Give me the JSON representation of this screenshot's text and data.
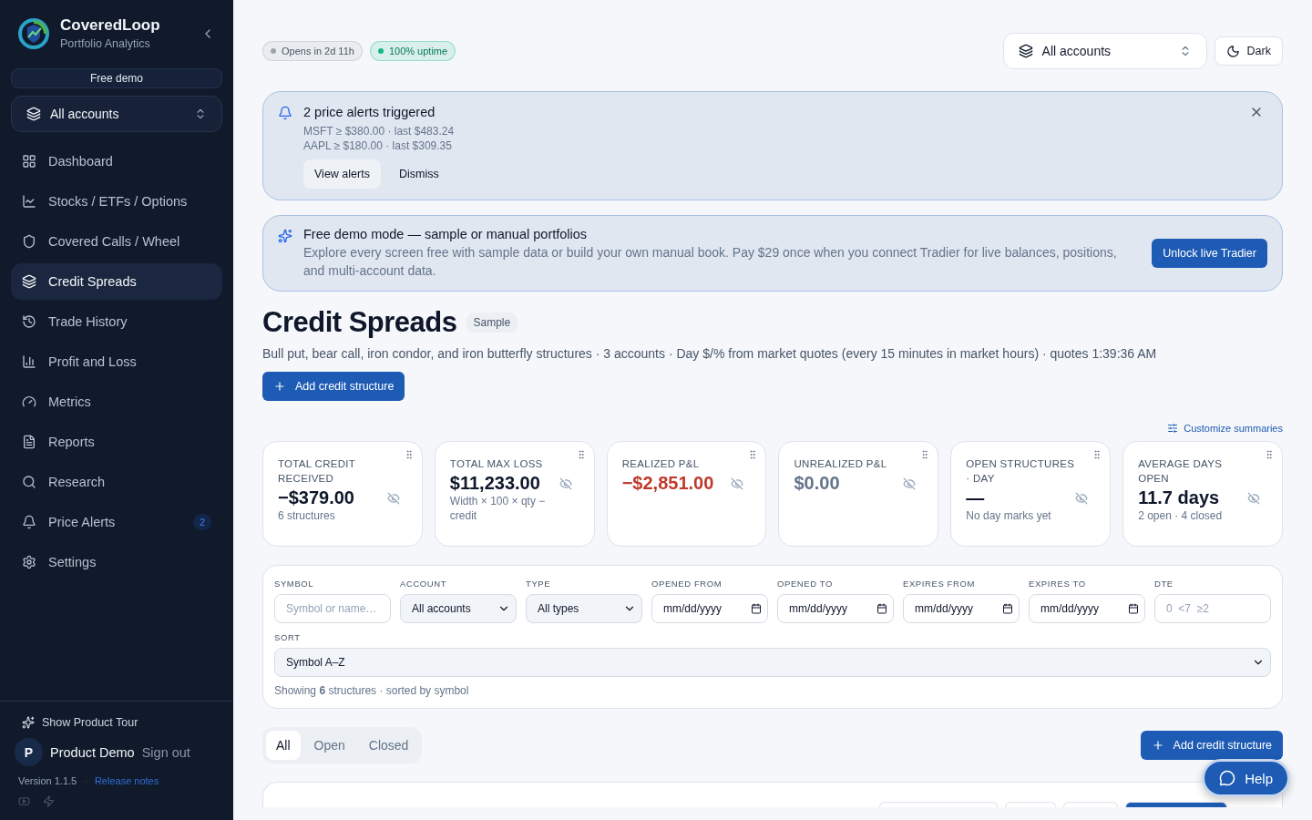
{
  "brand": {
    "name": "CoveredLoop",
    "tagline": "Portfolio Analytics"
  },
  "sidebar": {
    "plan_badge": "Free demo",
    "account_picker": "All accounts",
    "items": [
      {
        "label": "Dashboard",
        "selected": false
      },
      {
        "label": "Stocks / ETFs / Options",
        "selected": false
      },
      {
        "label": "Covered Calls / Wheel",
        "selected": false
      },
      {
        "label": "Credit Spreads",
        "selected": true
      },
      {
        "label": "Trade History",
        "selected": false
      },
      {
        "label": "Profit and Loss",
        "selected": false
      },
      {
        "label": "Metrics",
        "selected": false
      },
      {
        "label": "Reports",
        "selected": false
      },
      {
        "label": "Research",
        "selected": false
      },
      {
        "label": "Price Alerts",
        "selected": false,
        "badge": "2"
      },
      {
        "label": "Settings",
        "selected": false
      }
    ],
    "tour": "Show Product Tour",
    "avatar": "P",
    "user": "Product Demo",
    "sign_out": "Sign out",
    "version": "Version 1.1.5",
    "separator": "·",
    "release_notes": "Release notes"
  },
  "status_pills": [
    {
      "label": "Opens in 2d 11h",
      "color": "#9ca3af"
    },
    {
      "label": "100% uptime",
      "color": "#10b981"
    }
  ],
  "topbar": {
    "account_picker": "All accounts",
    "theme_button": "Dark"
  },
  "alert_banner": {
    "title": "2 price alerts triggered",
    "lines": [
      "MSFT ≥ $380.00 · last $483.24",
      "AAPL ≥ $180.00 · last $309.35"
    ],
    "buttons": [
      "View alerts",
      "Dismiss"
    ]
  },
  "demo_banner": {
    "title": "Free demo mode — sample or manual portfolios",
    "body": "Explore every screen free with sample data or build your own manual book. Pay $29 once when you connect Tradier for live balances, positions, and multi-account data.",
    "button": "Unlock live Tradier"
  },
  "page": {
    "title": "Credit Spreads",
    "badge": "Sample",
    "subtitle": "Bull put, bear call, iron condor, and iron butterfly structures · 3 accounts · Day $/% from market quotes (every 15 minutes in market hours) · quotes 1:39:36 AM",
    "add_button": "Add credit structure",
    "customize": "Customize summaries"
  },
  "summary_cards": [
    {
      "label": "TOTAL CREDIT RECEIVED",
      "value": "−$379.00",
      "color": "#0f172a",
      "note": "6 structures"
    },
    {
      "label": "TOTAL MAX LOSS",
      "value": "$11,233.00",
      "color": "#0f172a",
      "note": "Width × 100 × qty − credit"
    },
    {
      "label": "REALIZED P&L",
      "value": "−$2,851.00",
      "color": "#c0392b"
    },
    {
      "label": "UNREALIZED P&L",
      "value": "$0.00",
      "color": "#64748b"
    },
    {
      "label": "OPEN STRUCTURES · DAY",
      "value": "—",
      "color": "#0f172a",
      "note": "No day marks yet"
    },
    {
      "label": "AVERAGE DAYS OPEN",
      "value": "11.7 days",
      "color": "#0f172a",
      "note": "2 open · 4 closed"
    }
  ],
  "filters": [
    {
      "label": "SYMBOL",
      "kind": "text",
      "placeholder": "Symbol or name…"
    },
    {
      "label": "ACCOUNT",
      "kind": "select",
      "value": "All accounts"
    },
    {
      "label": "TYPE",
      "kind": "select",
      "value": "All types"
    },
    {
      "label": "OPENED FROM",
      "kind": "date",
      "value": "mm/dd/yyyy"
    },
    {
      "label": "OPENED TO",
      "kind": "date",
      "value": "mm/dd/yyyy"
    },
    {
      "label": "EXPIRES FROM",
      "kind": "date",
      "value": "mm/dd/yyyy"
    },
    {
      "label": "EXPIRES TO",
      "kind": "date",
      "value": "mm/dd/yyyy"
    },
    {
      "label": "DTE",
      "kind": "text",
      "placeholder": "0  <7  ≥2"
    }
  ],
  "sort": {
    "label": "SORT",
    "value": "Symbol A–Z"
  },
  "result_summary": "Showing **6** structures · sorted by symbol",
  "status_tabs": [
    {
      "label": "All",
      "selected": true
    },
    {
      "label": "Open",
      "selected": false
    },
    {
      "label": "Closed",
      "selected": false
    }
  ],
  "add_button_2": "Add credit structure",
  "help_button": "Help"
}
